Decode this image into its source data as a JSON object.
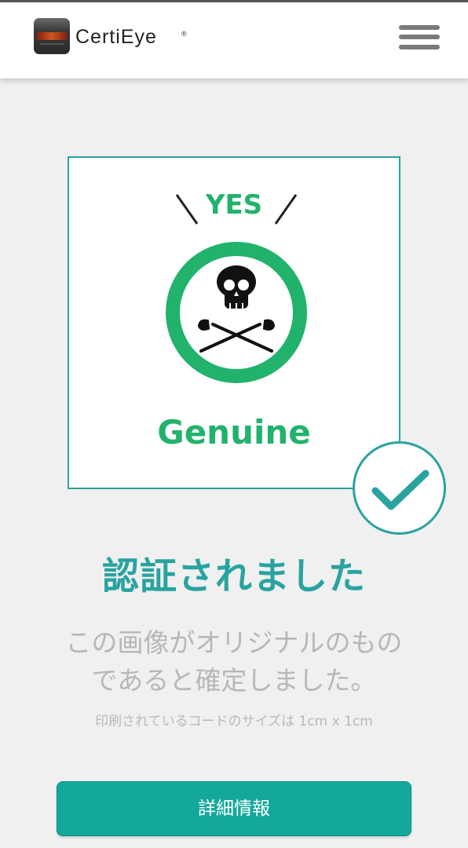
{
  "header": {
    "brand": "CertiEye",
    "brand_mark": "®",
    "logo_icon": "certieye-logo-icon",
    "menu_icon": "hamburger-menu-icon"
  },
  "code_image": {
    "top_text": "YES",
    "bottom_text": "Genuine",
    "emblem_icon": "skull-crossed-golf-clubs-icon",
    "accent_color": "#21b26c"
  },
  "verified_badge": {
    "icon": "checkmark-icon",
    "color": "#2aa3a0"
  },
  "result": {
    "title": "認証されました",
    "description_line1": "この画像がオリジナルのもの",
    "description_line2": "であると確定しました。",
    "size_note": "印刷されているコードのサイズは 1cm x 1cm"
  },
  "actions": {
    "detail_label": "詳細情報"
  },
  "colors": {
    "teal": "#2aa3a0",
    "button": "#13a89b",
    "green": "#21b26c"
  }
}
